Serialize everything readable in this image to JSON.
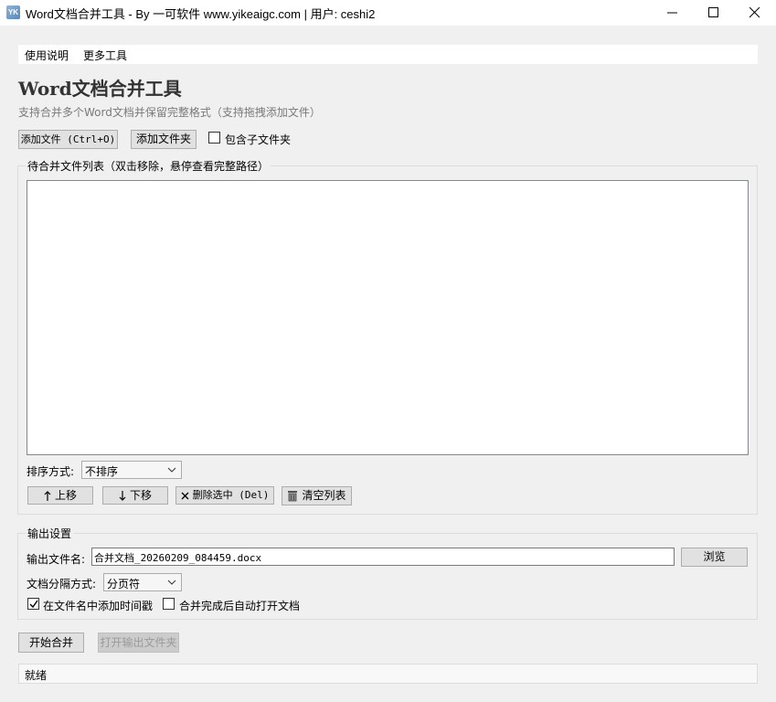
{
  "window": {
    "title": "Word文档合并工具 - By 一可软件 www.yikeaigc.com  | 用户: ceshi2",
    "app_icon_text": "YK"
  },
  "menu": {
    "items": [
      "使用说明",
      "更多工具"
    ]
  },
  "header": {
    "title": "Word文档合并工具",
    "subtitle": "支持合并多个Word文档并保留完整格式（支持拖拽添加文件）"
  },
  "toolbar": {
    "add_files": "添加文件 (Ctrl+O)",
    "add_folder": "添加文件夹",
    "include_subfolders": {
      "label": "包含子文件夹",
      "checked": false
    }
  },
  "file_list": {
    "title": "待合并文件列表（双击移除，悬停查看完整路径）",
    "items": [],
    "sort_label": "排序方式:",
    "sort_value": "不排序",
    "buttons": {
      "move_up": "上移",
      "move_down": "下移",
      "delete_selected": "删除选中 (Del)",
      "clear_list": "清空列表"
    },
    "icons": {
      "move_up": "arrow-up-icon",
      "move_down": "arrow-down-icon",
      "delete_selected": "close-icon",
      "clear_list": "trash-icon"
    }
  },
  "output": {
    "title": "输出设置",
    "filename_label": "输出文件名:",
    "filename_value": "合并文档_20260209_084459.docx",
    "browse": "浏览",
    "separator_label": "文档分隔方式:",
    "separator_value": "分页符",
    "add_timestamp": {
      "label": "在文件名中添加时间戳",
      "checked": true
    },
    "auto_open": {
      "label": "合并完成后自动打开文档",
      "checked": false
    }
  },
  "actions": {
    "start_merge": "开始合并",
    "open_output_folder": "打开输出文件夹",
    "open_output_folder_enabled": false
  },
  "status": {
    "text": "就绪"
  },
  "colors": {
    "window_bg": "#f0f0f0",
    "button_bg": "#e1e1e1",
    "subtitle_gray": "#7a7a7a"
  }
}
